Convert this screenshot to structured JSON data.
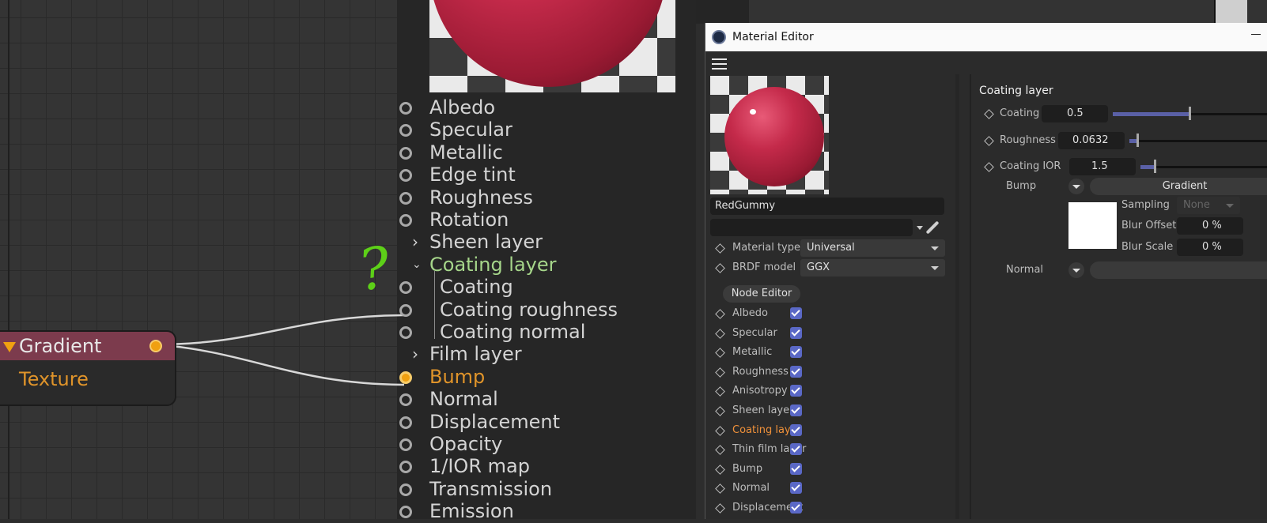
{
  "node_editor": {
    "ports": [
      {
        "label": "Albedo",
        "connected": false
      },
      {
        "label": "Specular",
        "connected": false
      },
      {
        "label": "Metallic",
        "connected": false
      },
      {
        "label": "Edge tint",
        "connected": false
      },
      {
        "label": "Roughness",
        "connected": false
      },
      {
        "label": "Rotation",
        "connected": false
      },
      {
        "label": "Sheen layer",
        "group": "collapsed"
      },
      {
        "label": "Coating layer",
        "group": "expanded"
      },
      {
        "label": "Coating",
        "connected": false,
        "sub": true
      },
      {
        "label": "Coating roughness",
        "connected": true,
        "sub": true
      },
      {
        "label": "Coating normal",
        "connected": false,
        "sub": true
      },
      {
        "label": "Film layer",
        "group": "collapsed"
      },
      {
        "label": "Bump",
        "connected": true
      },
      {
        "label": "Normal",
        "connected": false
      },
      {
        "label": "Displacement",
        "connected": false
      },
      {
        "label": "Opacity",
        "connected": false
      },
      {
        "label": "1/IOR map",
        "connected": false
      },
      {
        "label": "Transmission",
        "connected": false
      },
      {
        "label": "Emission",
        "connected": false
      }
    ],
    "gradient_node": {
      "title": "Gradient",
      "subtitle": "Texture",
      "header_color": "#7c3b4d"
    },
    "annotation": "?",
    "colors": {
      "coating_group": "#a6d68a",
      "bump_active": "#e0942a",
      "port_default": "#d4d4d4",
      "annotation": "#5dd018"
    }
  },
  "material_editor": {
    "title": "Material Editor",
    "material_name": "RedGummy",
    "material_type": {
      "label": "Material type",
      "value": "Universal"
    },
    "brdf_model": {
      "label": "BRDF model",
      "value": "GGX"
    },
    "node_editor_button": "Node Editor",
    "channels": [
      {
        "label": "Albedo",
        "checked": true,
        "active": false
      },
      {
        "label": "Specular",
        "checked": true,
        "active": false
      },
      {
        "label": "Metallic",
        "checked": true,
        "active": false
      },
      {
        "label": "Roughness",
        "checked": true,
        "active": false
      },
      {
        "label": "Anisotropy",
        "checked": true,
        "active": false
      },
      {
        "label": "Sheen layer",
        "checked": true,
        "active": false
      },
      {
        "label": "Coating layer",
        "checked": true,
        "active": true
      },
      {
        "label": "Thin film layer",
        "checked": true,
        "active": false
      },
      {
        "label": "Bump",
        "checked": true,
        "active": false
      },
      {
        "label": "Normal",
        "checked": true,
        "active": false
      },
      {
        "label": "Displacement",
        "checked": true,
        "active": false
      }
    ],
    "section": {
      "title": "Coating layer",
      "coating": {
        "label": "Coating",
        "value": "0.5",
        "level": 0.5
      },
      "roughness": {
        "label": "Roughness",
        "value": "0.0632",
        "level": 0.063
      },
      "coating_ior": {
        "label": "Coating IOR",
        "value": "1.5",
        "level": 0.12
      },
      "bump": {
        "label": "Bump",
        "shader": "Gradient",
        "sampling": {
          "label": "Sampling",
          "value": "None"
        },
        "blur_offset": {
          "label": "Blur Offset",
          "value": "0 %"
        },
        "blur_scale": {
          "label": "Blur Scale",
          "value": "0 %"
        }
      },
      "normal": {
        "label": "Normal",
        "shader": ""
      }
    },
    "colors": {
      "accent_active": "#f0913a",
      "checkbox": "#5a68c6",
      "slider_fill": "#5a60a6"
    }
  }
}
